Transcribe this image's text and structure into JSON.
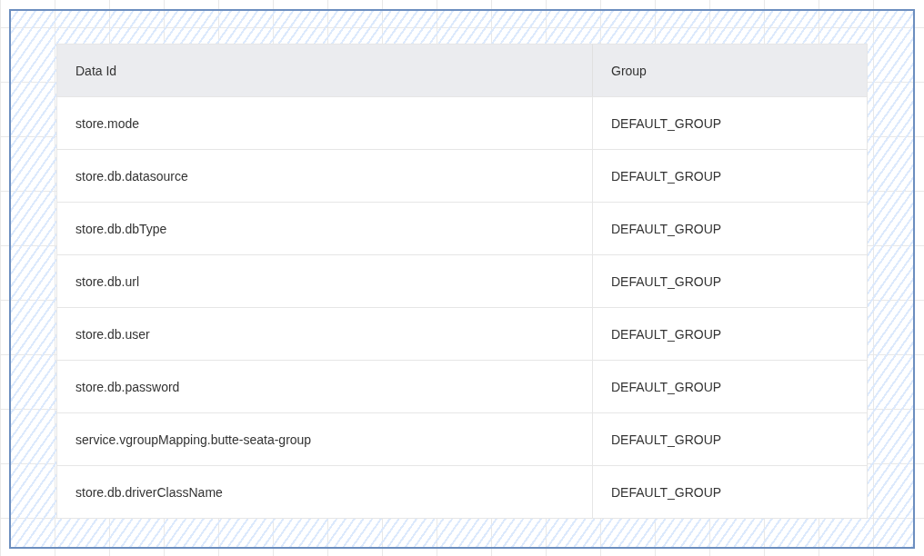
{
  "table": {
    "columns": [
      "Data Id",
      "Group"
    ],
    "rows": [
      [
        "store.mode",
        "DEFAULT_GROUP"
      ],
      [
        "store.db.datasource",
        "DEFAULT_GROUP"
      ],
      [
        "store.db.dbType",
        "DEFAULT_GROUP"
      ],
      [
        "store.db.url",
        "DEFAULT_GROUP"
      ],
      [
        "store.db.user",
        "DEFAULT_GROUP"
      ],
      [
        "store.db.password",
        "DEFAULT_GROUP"
      ],
      [
        "service.vgroupMapping.butte-seata-group",
        "DEFAULT_GROUP"
      ],
      [
        "store.db.driverClassName",
        "DEFAULT_GROUP"
      ]
    ]
  }
}
